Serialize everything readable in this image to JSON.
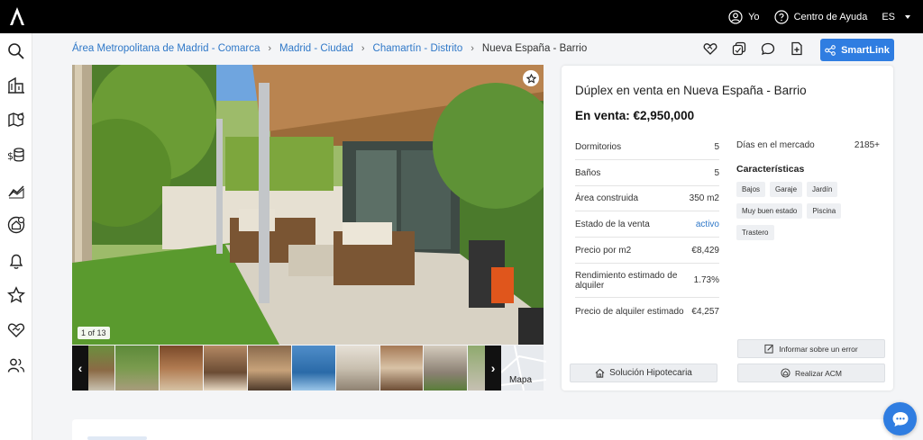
{
  "topbar": {
    "user_label": "Yo",
    "help_label": "Centro de Ayuda",
    "lang_label": "ES"
  },
  "sidebar": {
    "items": [
      "search-icon",
      "buildings-icon",
      "map-icon",
      "valuation-icon",
      "chart-icon",
      "home-alert-icon",
      "bell-icon",
      "star-icon",
      "handshake-icon",
      "users-icon"
    ]
  },
  "breadcrumb": {
    "items": [
      "Área Metropolitana de Madrid - Comarca",
      "Madrid - Ciudad",
      "Chamartín - Distrito"
    ],
    "current": "Nueva España - Barrio"
  },
  "actions": {
    "smartlink_label": "SmartLink"
  },
  "gallery": {
    "counter": "1 of 13",
    "map_label": "Mapa"
  },
  "listing": {
    "title": "Dúplex en venta en Nueva España - Barrio",
    "price": "En venta: €2,950,000",
    "facts": [
      {
        "label": "Dormitorios",
        "value": "5"
      },
      {
        "label": "Baños",
        "value": "5"
      },
      {
        "label": "Área construida",
        "value": "350 m2"
      },
      {
        "label": "Estado de la venta",
        "value": "activo"
      },
      {
        "label": "Precio por m2",
        "value": "€8,429"
      },
      {
        "label": "Rendimiento estimado de alquiler",
        "value": "1.73%"
      },
      {
        "label": "Precio de alquiler estimado",
        "value": "€4,257"
      }
    ],
    "days_label": "Días en el mercado",
    "days_value": "2185+",
    "features_title": "Características",
    "features": [
      "Bajos",
      "Garaje",
      "Jardín",
      "Muy buen estado",
      "Piscina",
      "Trastero"
    ],
    "mortgage_button": "Solución Hipotecaria",
    "report_button": "Informar sobre un error",
    "acm_button": "Realizar ACM"
  },
  "colors": {
    "accent": "#2f7de1",
    "link": "#2f78c8",
    "topbar": "#000000"
  }
}
